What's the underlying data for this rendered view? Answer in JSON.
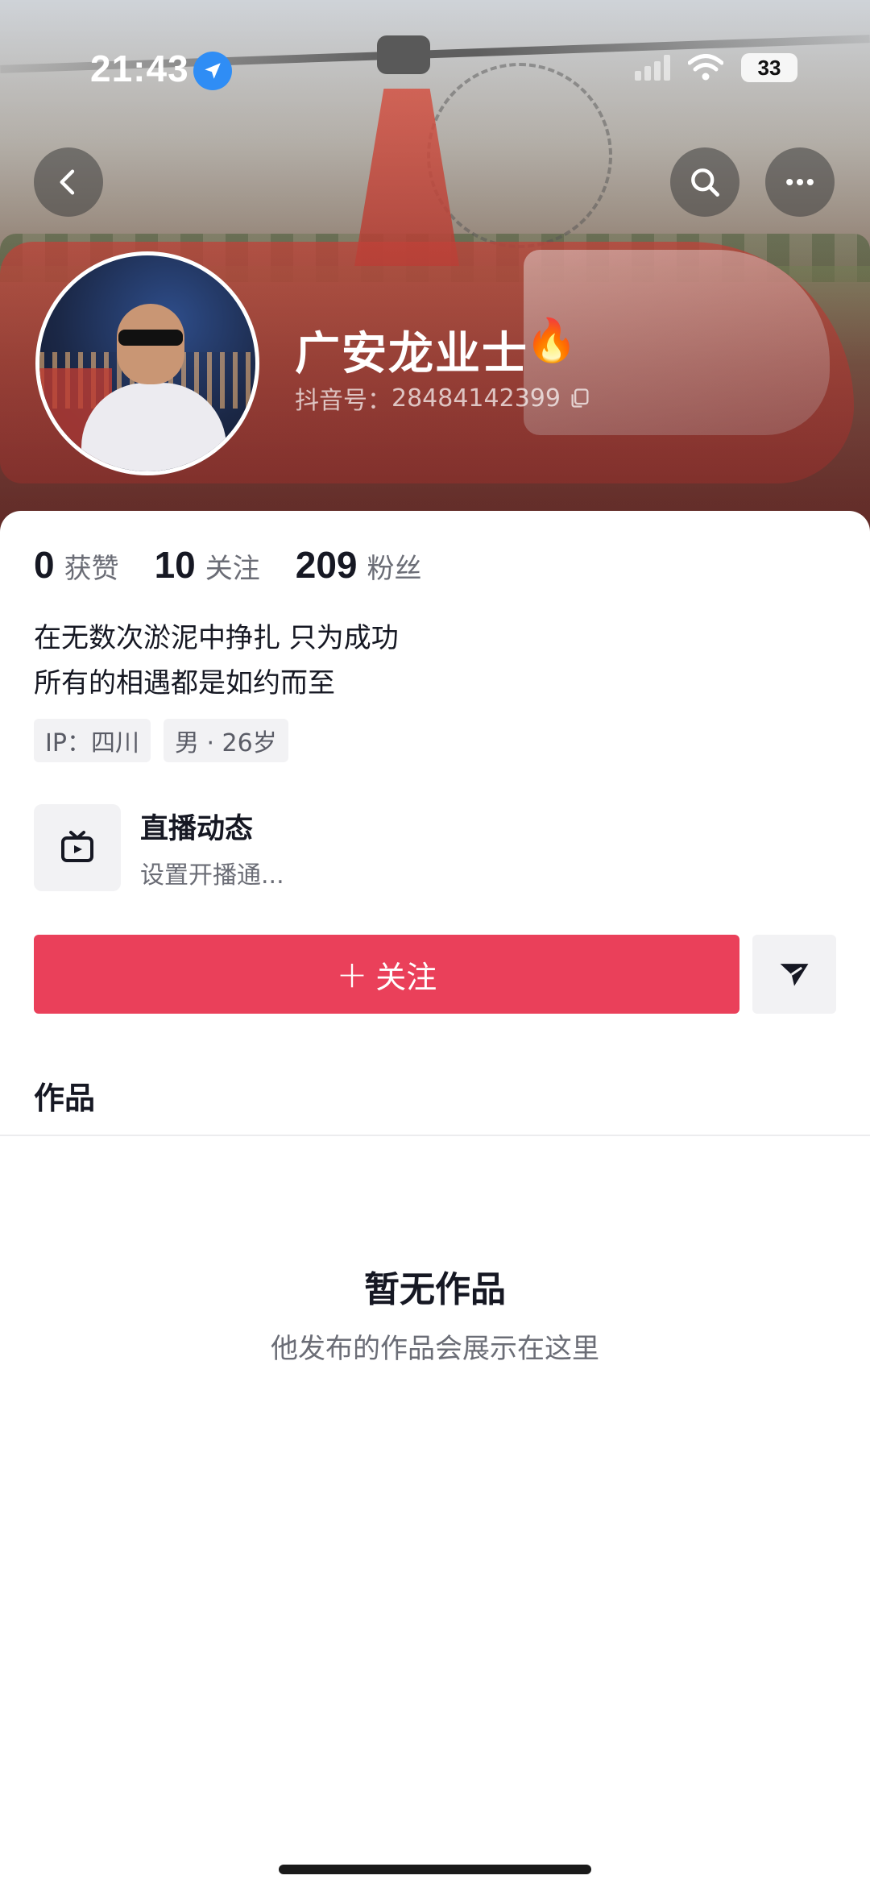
{
  "status_bar": {
    "time": "21:43",
    "battery": "33"
  },
  "profile": {
    "name": "广安龙业士",
    "name_emoji": "🔥",
    "douyin_id_label": "抖音号：",
    "douyin_id": "28484142399"
  },
  "stats": [
    {
      "value": "0",
      "label": "获赞"
    },
    {
      "value": "10",
      "label": "关注"
    },
    {
      "value": "209",
      "label": "粉丝"
    }
  ],
  "bio": {
    "line1": "在无数次淤泥中挣扎 只为成功",
    "line2": "所有的相遇都是如约而至"
  },
  "tags": [
    "IP：四川",
    "男 · 26岁"
  ],
  "live": {
    "title": "直播动态",
    "subtitle": "设置开播通..."
  },
  "actions": {
    "follow_plus": "+",
    "follow_label": "关注"
  },
  "tabs": {
    "works": "作品"
  },
  "empty_state": {
    "title": "暂无作品",
    "subtitle": "他发布的作品会展示在这里"
  },
  "colors": {
    "accent": "#ea405a",
    "location_badge": "#2f8df5",
    "text_primary": "#161823",
    "text_secondary": "#6b6d76"
  },
  "icons": [
    "location-arrow-icon",
    "signal-icon",
    "wifi-icon",
    "battery-icon",
    "back-icon",
    "search-icon",
    "more-icon",
    "copy-icon",
    "tv-icon",
    "share-icon"
  ]
}
